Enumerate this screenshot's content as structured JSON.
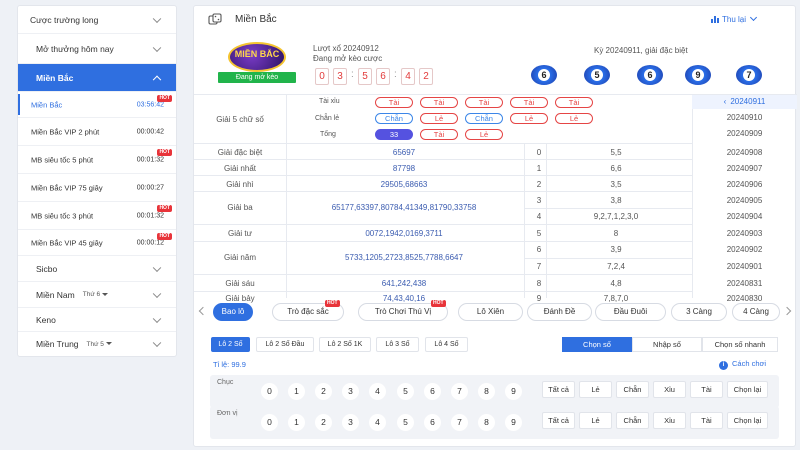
{
  "sidebar": {
    "items": [
      {
        "label": "Cược trường long"
      },
      {
        "label": "Mở thưởng hôm nay"
      },
      {
        "label": "Miền Bắc"
      },
      {
        "label": "Sicbo"
      },
      {
        "label": "Miền Nam",
        "extra": "Thứ 6"
      },
      {
        "label": "Keno"
      },
      {
        "label": "Miền Trung",
        "extra": "Thứ 5"
      }
    ],
    "games": [
      {
        "name": "Miền Bắc",
        "time": "03:56:42",
        "hot": "HOT"
      },
      {
        "name": "Miền Bắc VIP 2 phút",
        "time": "00:00:42"
      },
      {
        "name": "MB siêu tốc 5 phút",
        "time": "00:01:32",
        "hot": "HOT"
      },
      {
        "name": "Miền Bắc VIP 75 giây",
        "time": "00:00:27"
      },
      {
        "name": "MB siêu tốc 3 phút",
        "time": "00:01:32",
        "hot": "HOT"
      },
      {
        "name": "Miền Bắc VIP 45 giây",
        "time": "00:00:12",
        "hot": "HOT"
      }
    ]
  },
  "header": {
    "title": "Miền Bắc",
    "collapse": "Thu lại"
  },
  "draw": {
    "logo_text": "MIỀN BẮC",
    "status": "Đang mở kèo",
    "line": "Lượt xổ 20240912",
    "open": "Đang mở kèo cược",
    "countdown": [
      "0",
      "3",
      "5",
      "6",
      "4",
      "2"
    ],
    "prev_title": "Kỳ 20240911, giải đặc biệt",
    "balls": [
      "6",
      "5",
      "6",
      "9",
      "7"
    ]
  },
  "g5": {
    "label": "Giải 5 chữ số",
    "taixiu_label": "Tài xỉu",
    "taixiu": [
      "Tài",
      "Tài",
      "Tài",
      "Tài",
      "Tài"
    ],
    "chanle_label": "Chẵn lẻ",
    "chanle": [
      "Chẵn",
      "Lẻ",
      "Chẵn",
      "Lẻ",
      "Lẻ"
    ],
    "tong_label": "Tổng",
    "tong": [
      "33",
      "Tài",
      "Lẻ"
    ]
  },
  "prizes": [
    {
      "name": "Giải đặc biệt",
      "value": "65697"
    },
    {
      "name": "Giải nhất",
      "value": "87798"
    },
    {
      "name": "Giải nhì",
      "value": "29505,68663"
    },
    {
      "name": "Giải ba",
      "value": "65177,63397,80784,41349,81790,33758"
    },
    {
      "name": "Giải tư",
      "value": "0072,1942,0169,3711"
    },
    {
      "name": "Giải năm",
      "value": "5733,1205,2723,8525,7788,6647"
    },
    {
      "name": "Giải sáu",
      "value": "641,242,438"
    },
    {
      "name": "Giải bảy",
      "value": "74,43,40,16"
    }
  ],
  "tails": [
    {
      "n": "0",
      "v": "5,5"
    },
    {
      "n": "1",
      "v": "6,6"
    },
    {
      "n": "2",
      "v": "3,5"
    },
    {
      "n": "3",
      "v": "3,8"
    },
    {
      "n": "4",
      "v": "9,2,7,1,2,3,0"
    },
    {
      "n": "5",
      "v": "8"
    },
    {
      "n": "6",
      "v": "3,9"
    },
    {
      "n": "7",
      "v": "7,2,4"
    },
    {
      "n": "8",
      "v": "4,8"
    },
    {
      "n": "9",
      "v": "7,8,7,0"
    }
  ],
  "dates": [
    "20240911",
    "20240910",
    "20240909",
    "20240908",
    "20240907",
    "20240906",
    "20240905",
    "20240904",
    "20240903",
    "20240902",
    "20240901",
    "20240831",
    "20240830"
  ],
  "tabs": [
    {
      "label": "Bao lô"
    },
    {
      "label": "Trò đặc sắc",
      "hot": "HOT"
    },
    {
      "label": "Trò Chơi Thú Vị",
      "hot": "HOT"
    },
    {
      "label": "Lô Xiên"
    },
    {
      "label": "Đánh Đề"
    },
    {
      "label": "Đầu Đuôi"
    },
    {
      "label": "3 Càng"
    },
    {
      "label": "4 Càng"
    }
  ],
  "subtabs": [
    "Lô 2 Số",
    "Lô 2 Số Đầu",
    "Lô 2 Số 1K",
    "Lô 3 Số",
    "Lô 4 Số"
  ],
  "modes": [
    "Chọn số",
    "Nhập số",
    "Chọn số nhanh"
  ],
  "ratio": "Tỉ lệ:  99.9",
  "howto": "Cách chơi",
  "pick": {
    "rows": [
      "Chục",
      "Đơn vị"
    ],
    "digits": [
      "0",
      "1",
      "2",
      "3",
      "4",
      "5",
      "6",
      "7",
      "8",
      "9"
    ],
    "filters": [
      "Tất cả",
      "Lẻ",
      "Chẵn",
      "Xỉu",
      "Tài",
      "Chọn lại"
    ]
  }
}
